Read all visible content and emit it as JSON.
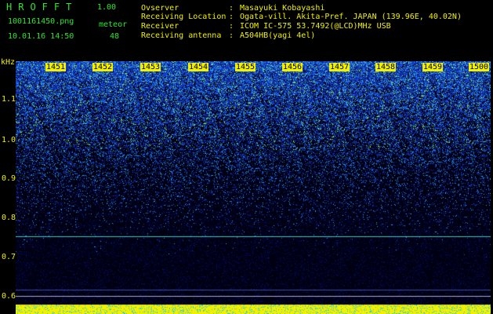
{
  "header": {
    "app_title": "HROFFT",
    "version": "1.00",
    "filename": "1001161450.png",
    "meteor_label": "meteor",
    "datetime": "10.01.16 14:50",
    "meteor_count": "48"
  },
  "station": {
    "rows": [
      {
        "label": "Ovserver",
        "value": "Masayuki Kobayashi"
      },
      {
        "label": "Receiving Location",
        "value": "Ogata-vill. Akita-Pref. JAPAN (139.96E, 40.02N)"
      },
      {
        "label": "Receiver",
        "value": "ICOM IC-575 53.7492(@LCD)MHz USB"
      },
      {
        "label": "Receiving antenna",
        "value": "A504HB(yagi 4el)"
      }
    ],
    "separator": ":"
  },
  "axes": {
    "y_unit": "kHz",
    "y_ticks": [
      "1.1",
      "1.0",
      "0.9",
      "0.8",
      "0.7",
      "0.6"
    ],
    "x_ticks": [
      "1451",
      "1452",
      "1453",
      "1454",
      "1455",
      "1456",
      "1457",
      "1458",
      "1459",
      "1500"
    ]
  },
  "colors": {
    "text_green": "#2ee62e",
    "text_yellow": "#f0f000",
    "background": "#000000",
    "carrier_line": "#3cc8b4"
  }
}
